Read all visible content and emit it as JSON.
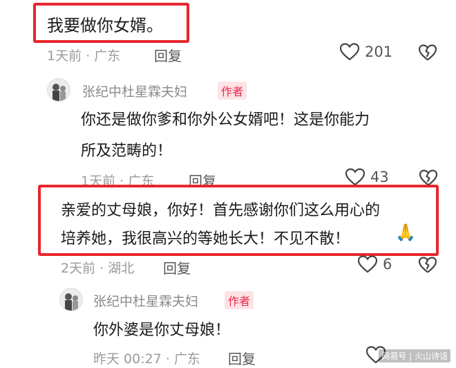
{
  "comments": [
    {
      "text": "我要做你女婿。",
      "meta": "1天前 · 广东",
      "reply": "回复",
      "likes": "201"
    },
    {
      "username": "张纪中杜星霖夫妇",
      "badge": "作者",
      "text_line1": "你还是做你爹和你外公女婿吧！这是你能力",
      "text_line2": "所及范畴的！",
      "meta": "1天前 · 广东",
      "reply": "回复",
      "likes": "43"
    },
    {
      "text_line1": "亲爱的丈母娘，你好！首先感谢你们这么用心的",
      "text_line2": "培养她，我很高兴的等她长大！不见不散！",
      "emoji": "🙏",
      "meta": "2天前 · 湖北",
      "reply": "回复",
      "likes": "6"
    },
    {
      "username": "张纪中杜星霖夫妇",
      "badge": "作者",
      "text": "你外婆是你丈母娘！",
      "meta": "昨天 00:27 · 广东",
      "reply": "回复"
    }
  ],
  "watermark": "网易号 | 火山诗话",
  "colors": {
    "highlight": "#e8262c",
    "badge_bg": "#fde3e6",
    "badge_text": "#e8264b"
  }
}
